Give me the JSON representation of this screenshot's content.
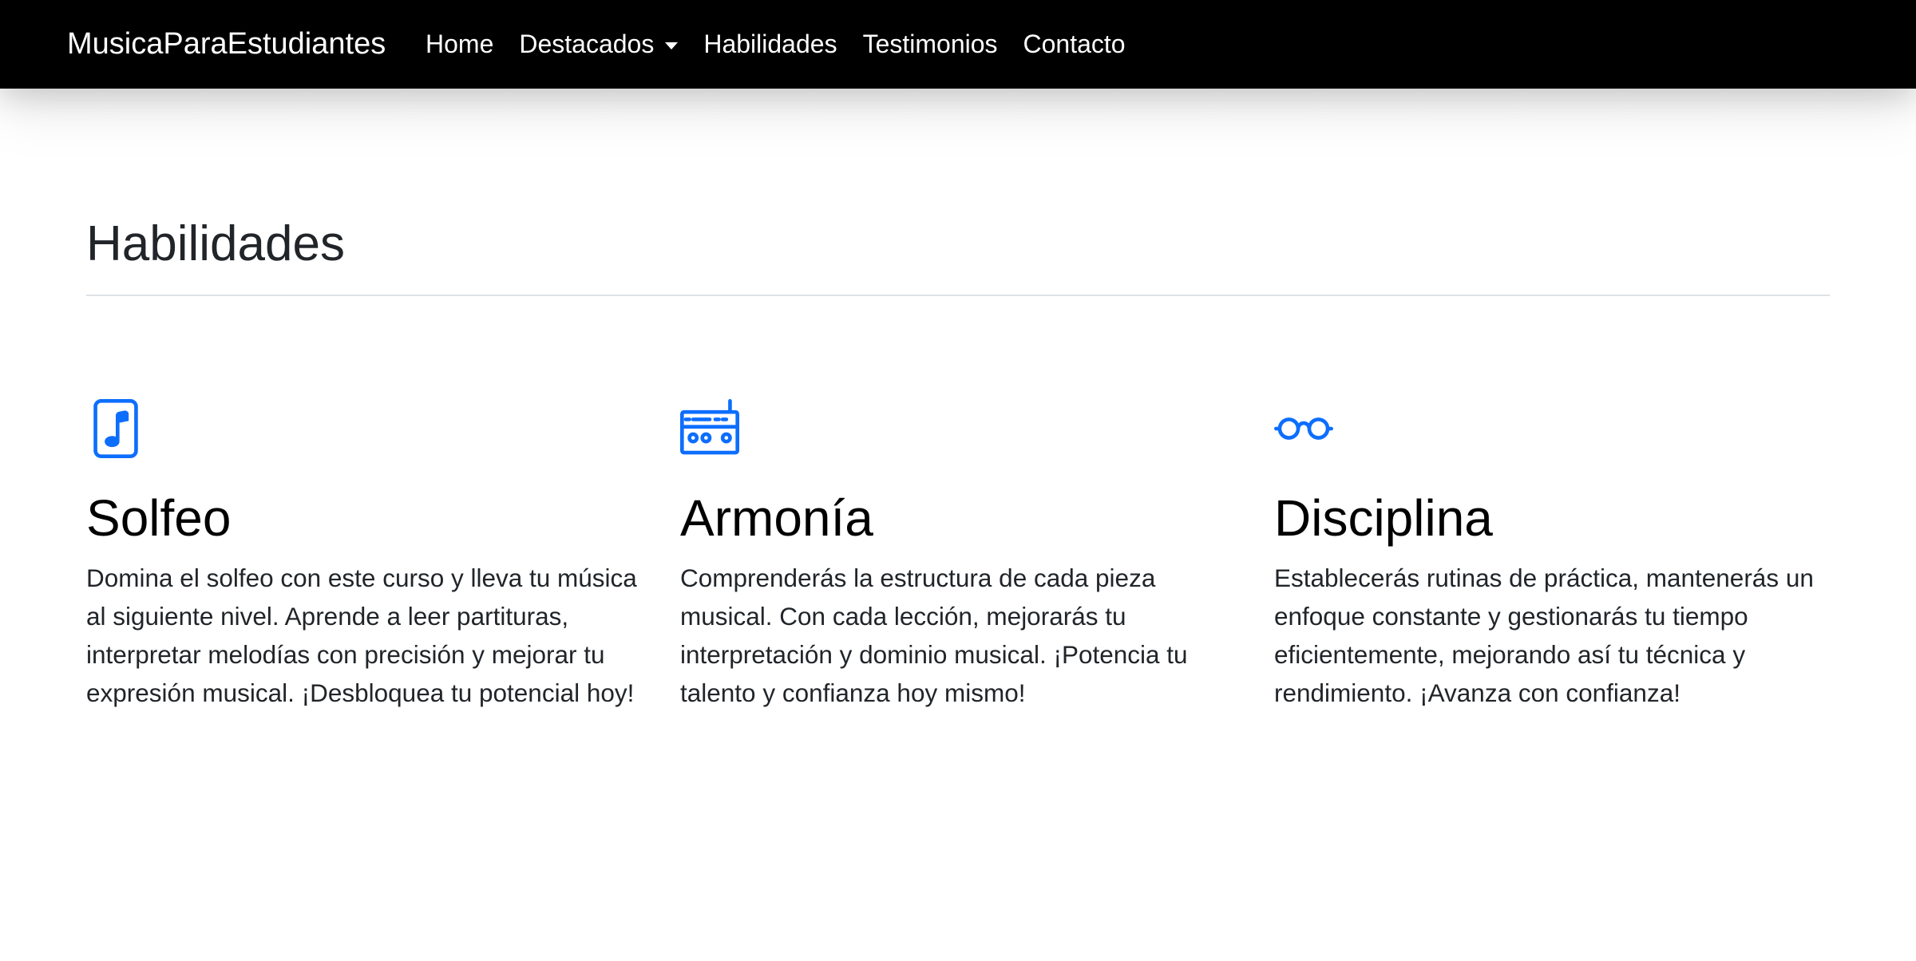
{
  "nav": {
    "brand": "MusicaParaEstudiantes",
    "links": [
      {
        "label": "Home"
      },
      {
        "label": "Destacados",
        "dropdown": true
      },
      {
        "label": "Habilidades"
      },
      {
        "label": "Testimonios"
      },
      {
        "label": "Contacto"
      }
    ]
  },
  "section": {
    "title": "Habilidades"
  },
  "features": [
    {
      "icon": "music-file-icon",
      "title": "Solfeo",
      "text": "Domina el solfeo con este curso y lleva tu música al siguiente nivel. Aprende a leer partituras, interpretar melodías con precisión y mejorar tu expresión musical. ¡Desbloquea tu potencial hoy!"
    },
    {
      "icon": "boombox-icon",
      "title": "Armonía",
      "text": "Comprenderás la estructura de cada pieza musical. Con cada lección, mejorarás tu interpretación y dominio musical. ¡Potencia tu talento y confianza hoy mismo!"
    },
    {
      "icon": "eyeglasses-icon",
      "title": "Disciplina",
      "text": "Establecerás rutinas de práctica, mantenerás un enfoque constante y gestionarás tu tiempo eficientemente, mejorando así tu técnica y rendimiento. ¡Avanza con confianza!"
    }
  ],
  "colors": {
    "navbar_bg": "#000000",
    "accent": "#0d6efd",
    "text": "#212529"
  }
}
